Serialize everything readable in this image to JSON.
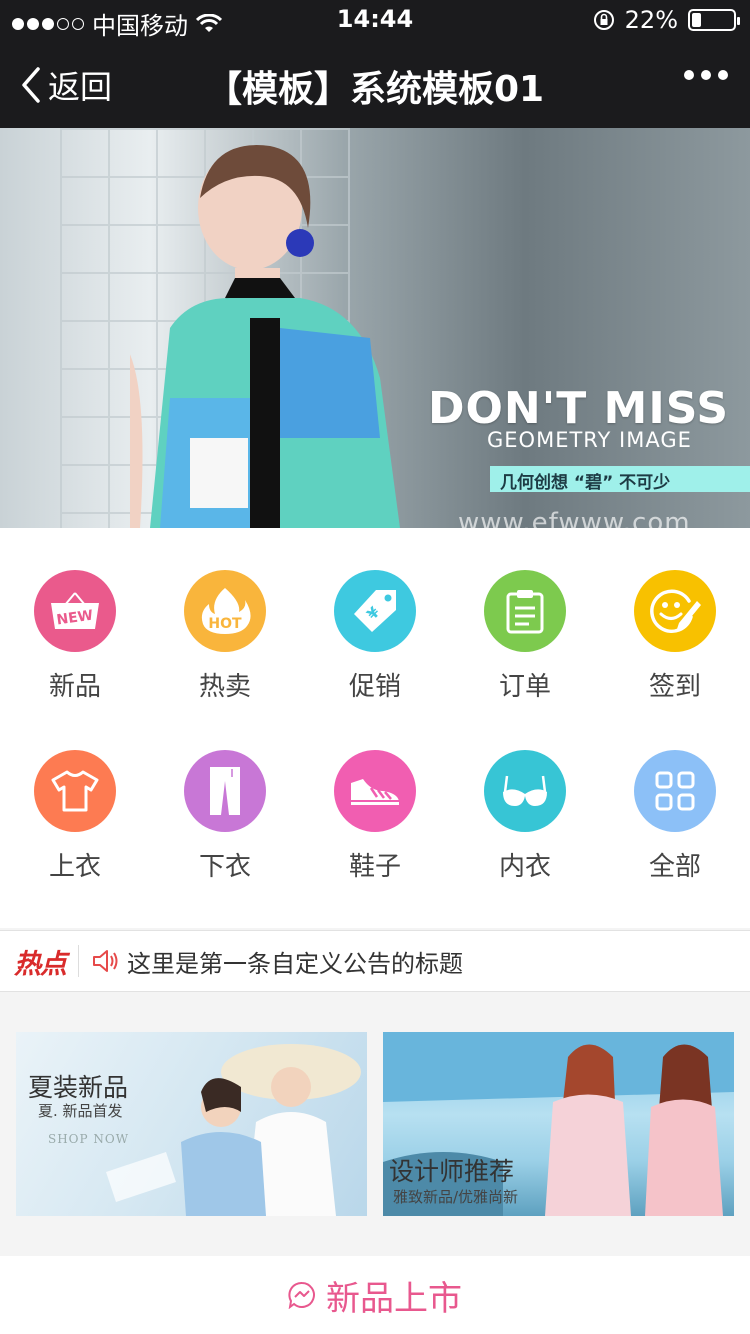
{
  "status_bar": {
    "carrier": "中国移动",
    "time": "14:44",
    "battery_text": "22%",
    "battery_level": 0.22
  },
  "nav": {
    "back_label": "返回",
    "title": "【模板】系统模板01"
  },
  "banner": {
    "headline": "DON'T MISS",
    "subline": "GEOMETRY IMAGE",
    "tagline": "几何创想 “碧” 不可少",
    "url": "www.efwww.com",
    "slide_count": 3
  },
  "menu": {
    "items": [
      {
        "label": "新品",
        "icon": "new-tag-icon",
        "color": "#ea5a8c"
      },
      {
        "label": "热卖",
        "icon": "hot-flame-icon",
        "color": "#f9b53c"
      },
      {
        "label": "促销",
        "icon": "price-tag-icon",
        "color": "#3ec9e0"
      },
      {
        "label": "订单",
        "icon": "clipboard-icon",
        "color": "#7dca4e"
      },
      {
        "label": "签到",
        "icon": "smile-sign-icon",
        "color": "#f8c100"
      },
      {
        "label": "上衣",
        "icon": "tshirt-icon",
        "color": "#fd7b52"
      },
      {
        "label": "下衣",
        "icon": "trousers-icon",
        "color": "#c877d6"
      },
      {
        "label": "鞋子",
        "icon": "sneaker-icon",
        "color": "#f15eb1"
      },
      {
        "label": "内衣",
        "icon": "bra-icon",
        "color": "#37c5d5"
      },
      {
        "label": "全部",
        "icon": "grid-icon",
        "color": "#8cc0f7"
      }
    ]
  },
  "notice": {
    "badge": "热点",
    "text": "这里是第一条自定义公告的标题"
  },
  "promos": [
    {
      "title": "夏装新品",
      "subtitle": "夏. 新品首发",
      "cta": "SHOP NOW"
    },
    {
      "title": "设计师推荐",
      "subtitle": "雅致新品/优雅尚新"
    }
  ],
  "section": {
    "title": "新品上市",
    "accent": "#e8588e"
  }
}
